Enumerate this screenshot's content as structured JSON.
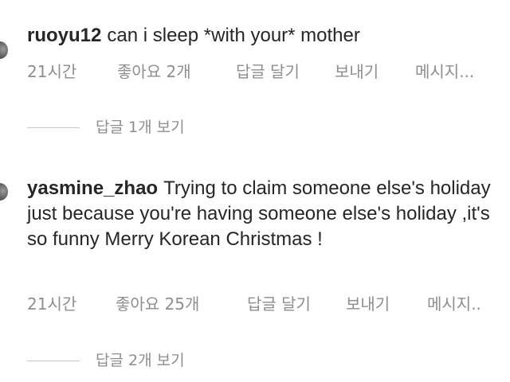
{
  "comments": [
    {
      "username": "ruoyu12",
      "text": "can i sleep *with your* mother",
      "time": "21시간",
      "likes": "좋아요 2개",
      "reply": "답글 달기",
      "send": "보내기",
      "message": "메시지...",
      "view_replies": "답글 1개 보기"
    },
    {
      "username": "yasmine_zhao",
      "text": "Trying to claim someone else's holiday just because you're having someone else's holiday ,it's so funny  Merry Korean Christmas !",
      "time": "21시간",
      "likes": "좋아요 25개",
      "reply": "답글 달기",
      "send": "보내기",
      "message": "메시지..",
      "view_replies": "답글 2개 보기"
    }
  ]
}
